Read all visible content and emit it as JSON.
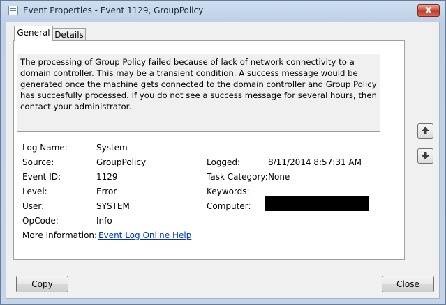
{
  "window": {
    "title": "Event Properties - Event 1129, GroupPolicy",
    "close_glyph": "X"
  },
  "tabs": [
    {
      "label": "General",
      "selected": true
    },
    {
      "label": "Details",
      "selected": false
    }
  ],
  "description": "The processing of Group Policy failed because of lack of network connectivity to a domain controller. This may be a transient condition. A success message would be generated once the machine gets connected to the domain controller and Group Policy has succesfully processed. If you do not see a success message for several hours, then contact your administrator.",
  "fields": {
    "log_name": {
      "label": "Log Name:",
      "value": "System"
    },
    "source": {
      "label": "Source:",
      "value": "GroupPolicy"
    },
    "event_id": {
      "label": "Event ID:",
      "value": "1129"
    },
    "level": {
      "label": "Level:",
      "value": "Error"
    },
    "user": {
      "label": "User:",
      "value": "SYSTEM"
    },
    "opcode": {
      "label": "OpCode:",
      "value": "Info"
    },
    "more_info": {
      "label": "More Information:",
      "value": "Event Log Online Help"
    },
    "logged": {
      "label": "Logged:",
      "value": "8/11/2014 8:57:31 AM"
    },
    "task_category": {
      "label": "Task Category:",
      "value": "None"
    },
    "keywords": {
      "label": "Keywords:",
      "value": ""
    },
    "computer": {
      "label": "Computer:",
      "value": ""
    }
  },
  "buttons": {
    "copy": "Copy",
    "close": "Close"
  },
  "icons": {
    "nav_up": "up-arrow-icon",
    "nav_down": "down-arrow-icon"
  }
}
